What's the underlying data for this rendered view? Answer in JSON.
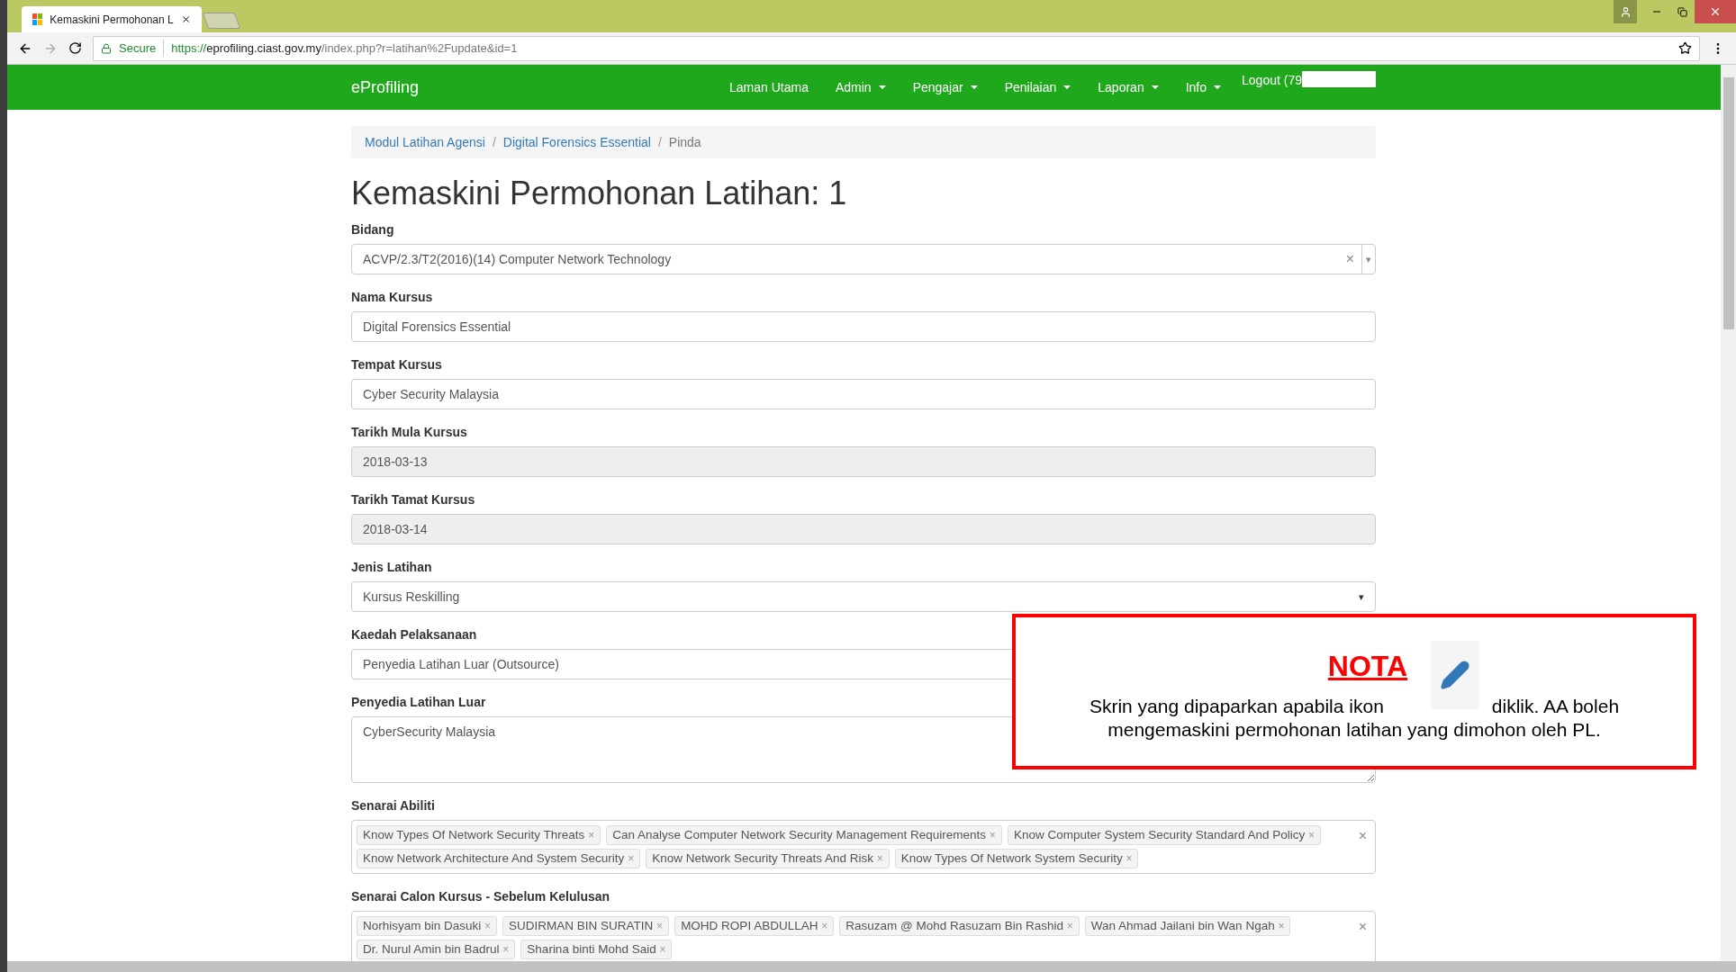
{
  "browser": {
    "tab_title": "Kemaskini Permohonan L",
    "secure_label": "Secure",
    "url_scheme": "https://",
    "url_host": "eprofiling.ciast.gov.my",
    "url_path": "/index.php?r=latihan%2Fupdate&id=1"
  },
  "navbar": {
    "brand": "eProfiling",
    "items": [
      {
        "label": "Laman Utama",
        "dropdown": false
      },
      {
        "label": "Admin",
        "dropdown": true
      },
      {
        "label": "Pengajar",
        "dropdown": true
      },
      {
        "label": "Penilaian",
        "dropdown": true
      },
      {
        "label": "Laporan",
        "dropdown": true
      },
      {
        "label": "Info",
        "dropdown": true
      }
    ],
    "logout": "Logout (79"
  },
  "breadcrumb_separator": "/",
  "breadcrumb": [
    {
      "label": "Modul Latihan Agensi",
      "link": true
    },
    {
      "label": "Digital Forensics Essential",
      "link": true
    },
    {
      "label": "Pinda",
      "link": false
    }
  ],
  "title": "Kemaskini Permohonan Latihan: 1",
  "fields": [
    {
      "label": "Bidang",
      "kind": "select2",
      "value": "ACVP/2.3/T2(2016)(14) Computer Network Technology",
      "disabled": false
    },
    {
      "label": "Nama Kursus",
      "kind": "text",
      "value": "Digital Forensics Essential",
      "disabled": false
    },
    {
      "label": "Tempat Kursus",
      "kind": "text",
      "value": "Cyber Security Malaysia",
      "disabled": false
    },
    {
      "label": "Tarikh Mula Kursus",
      "kind": "text",
      "value": "2018-03-13",
      "disabled": true
    },
    {
      "label": "Tarikh Tamat Kursus",
      "kind": "text",
      "value": "2018-03-14",
      "disabled": true
    },
    {
      "label": "Jenis Latihan",
      "kind": "select",
      "value": "Kursus Reskilling",
      "disabled": false
    },
    {
      "label": "Kaedah Pelaksanaan",
      "kind": "select",
      "value": "Penyedia Latihan Luar (Outsource)",
      "disabled": false
    },
    {
      "label": "Penyedia Latihan Luar",
      "kind": "textarea",
      "value": "CyberSecurity Malaysia",
      "disabled": false
    }
  ],
  "tag_fields": [
    {
      "label": "Senarai Abiliti",
      "tags": [
        "Know Types Of Network Security Threats",
        "Can Analyse Computer Network Security Management Requirements",
        "Know Computer System Security Standard And Policy",
        "Know Network Architecture And System Security",
        "Know Network Security Threats And Risk",
        "Know Types Of Network System Security"
      ]
    },
    {
      "label": "Senarai Calon Kursus - Sebelum Kelulusan",
      "tags": [
        "Norhisyam bin Dasuki",
        "SUDIRMAN BIN SURATIN",
        "MOHD ROPI ABDULLAH",
        "Rasuzam @ Mohd Rasuzam Bin Rashid",
        "Wan Ahmad Jailani bin Wan Ngah",
        "Dr. Nurul Amin bin Badrul",
        "Sharina binti Mohd Said"
      ]
    }
  ],
  "remove_glyph": "×",
  "clear_glyph": "×",
  "caret_glyph": "▾",
  "note": {
    "title": "NOTA",
    "text_before": "Skrin yang dipaparkan apabila ikon",
    "text_after": "diklik. AA boleh",
    "text_line2": "mengemaskini permohonan latihan yang dimohon oleh PL."
  }
}
